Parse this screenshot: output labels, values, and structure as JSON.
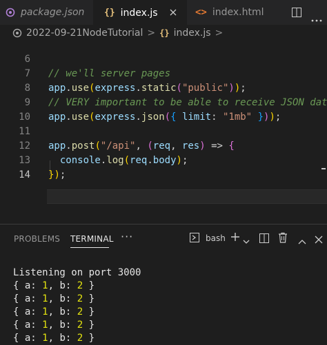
{
  "tabs": [
    {
      "icon": "node-package-icon",
      "label": "package.json",
      "italic": true
    },
    {
      "icon": "js-file-icon",
      "icon_text": "{}",
      "label": "index.js",
      "active": true
    },
    {
      "icon": "html-file-icon",
      "icon_text": "<>",
      "label": "index.html"
    }
  ],
  "breadcrumb": {
    "folder": "2022-09-21NodeTutorial",
    "sep": ">",
    "file_icon_text": "{}",
    "file": "index.js",
    "trail": ">"
  },
  "editor": {
    "line_numbers": [
      "6",
      "7",
      "8",
      "9",
      "10",
      "11",
      "12",
      "13",
      "14"
    ],
    "current_line": "14",
    "lines": [
      "// we'll server pages",
      "app.use(express.static(\"public\"));",
      "// VERY important to be able to receive JSON data",
      "app.use(express.json({ limit: \"1mb\" }));",
      "",
      "app.post(\"/api\", (req, res) => {",
      "  console.log(req.body);",
      "});",
      ""
    ]
  },
  "panel": {
    "tabs": {
      "problems": "PROBLEMS",
      "terminal": "TERMINAL",
      "more": "···"
    },
    "terminal_name": "bash",
    "output": [
      "Listening on port 3000",
      "{ a: 1, b: 2 }",
      "{ a: 1, b: 2 }",
      "{ a: 1, b: 2 }",
      "{ a: 1, b: 2 }",
      "{ a: 1, b: 2 }"
    ]
  },
  "colors": {
    "editor_bg": "#1e1e1e",
    "tab_bar_bg": "#252526",
    "keyword_blue": "#569cd6",
    "string": "#ce9178",
    "comment": "#6a9955",
    "number_terminal": "#e5e510"
  }
}
